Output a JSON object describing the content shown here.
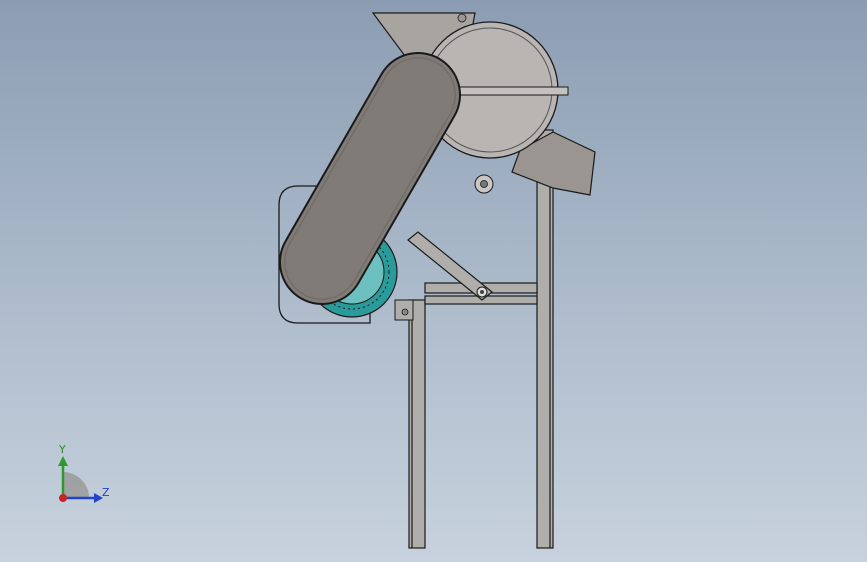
{
  "triad": {
    "y_label": "Y",
    "z_label": "Z",
    "y_color": "#2e9a2e",
    "z_color": "#2244cc",
    "x_color": "#cc2222"
  },
  "colors": {
    "belt_guard": "#807b76",
    "machine_body": "#a8a5a1",
    "motor": "#2a9a9a",
    "frame": "#b0aeab",
    "outline": "#1a1a1a"
  }
}
